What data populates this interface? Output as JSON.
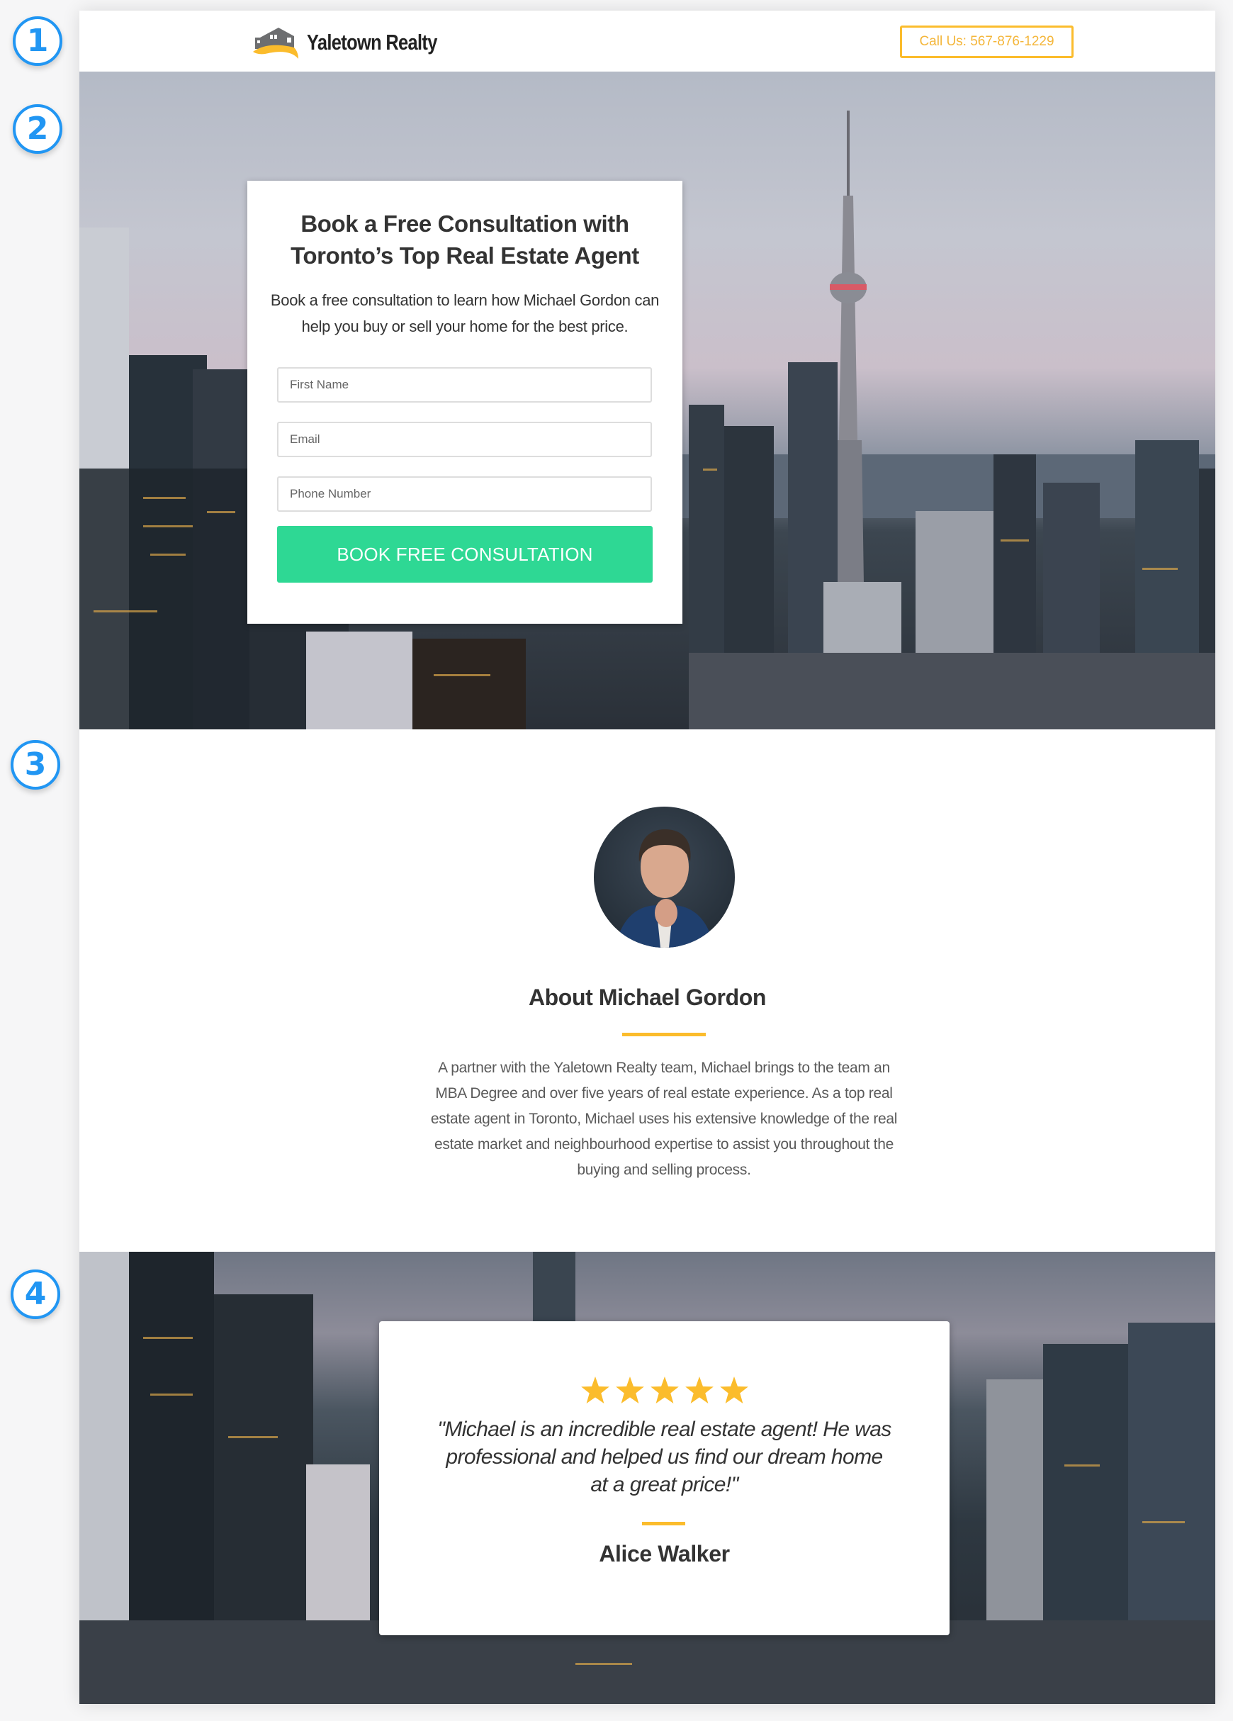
{
  "annotations": [
    "1",
    "2",
    "3",
    "4"
  ],
  "header": {
    "brand": "Yaletown Realty",
    "call_button": "Call Us: 567-876-1229",
    "logo_icon": "house-logo-icon"
  },
  "hero": {
    "title_line1": "Book a Free Consultation with",
    "title_line2": "Toronto’s Top Real Estate Agent",
    "subtitle": "Book a free consultation to learn how Michael Gordon can help you buy or sell your home for the best price.",
    "fields": [
      {
        "placeholder": "First Name",
        "value": ""
      },
      {
        "placeholder": "Email",
        "value": ""
      },
      {
        "placeholder": "Phone Number",
        "value": ""
      }
    ],
    "submit_label": "BOOK FREE CONSULTATION",
    "background": "toronto-skyline-cn-tower-photo"
  },
  "about": {
    "avatar": "michael-gordon-portrait-photo",
    "title": "About Michael Gordon",
    "text": "A partner with the Yaletown Realty team, Michael brings to the team an MBA Degree and over five years of real estate experience. As a top real estate agent in Toronto, Michael uses his extensive knowledge of the real estate market and neighbourhood expertise to assist you throughout the buying and selling process."
  },
  "testimonial": {
    "rating": 5,
    "rating_max": 5,
    "quote": "\"Michael is an incredible real estate agent! He was professional and helped us find our dream home at a great price!\"",
    "author": "Alice Walker",
    "background": "toronto-downtown-city-photo"
  },
  "colors": {
    "accent": "#fbbc2c",
    "cta": "#2ed894",
    "badge": "#2196f3",
    "text": "#333333"
  }
}
